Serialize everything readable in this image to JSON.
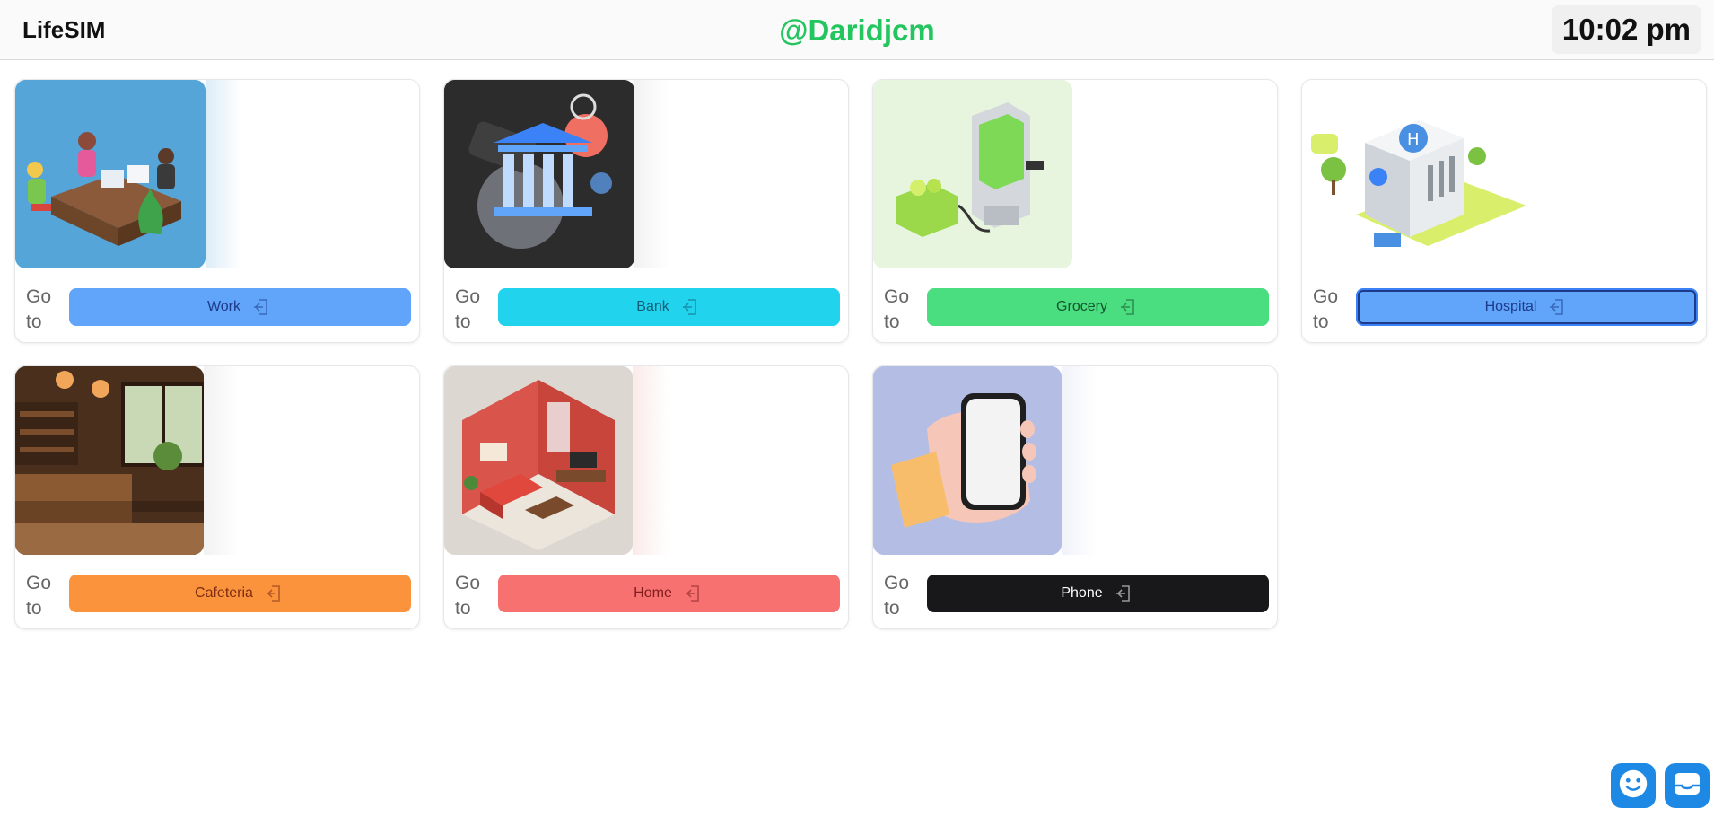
{
  "header": {
    "brand": "LifeSIM",
    "username": "@Daridjcm",
    "time": "10:02 pm"
  },
  "cards": [
    {
      "goto_text": "Go to",
      "label": "Work",
      "bg": "#60a5fa",
      "text_color": "#1e3a8a",
      "image": "office-workers-illustration"
    },
    {
      "goto_text": "Go to",
      "label": "Bank",
      "bg": "#22d3ee",
      "text_color": "#155e75",
      "image": "bank-building-illustration"
    },
    {
      "goto_text": "Go to",
      "label": "Grocery",
      "bg": "#4ade80",
      "text_color": "#14532d",
      "image": "grocery-kiosk-illustration"
    },
    {
      "goto_text": "Go to",
      "label": "Hospital",
      "bg": "#60a5fa",
      "text_color": "#1e3a8a",
      "image": "hospital-building-illustration"
    },
    {
      "goto_text": "Go to",
      "label": "Cafeteria",
      "bg": "#fb923c",
      "text_color": "#7c2d12",
      "image": "cafeteria-interior-illustration"
    },
    {
      "goto_text": "Go to",
      "label": "Home",
      "bg": "#f87171",
      "text_color": "#7f1d1d",
      "image": "living-room-illustration"
    },
    {
      "goto_text": "Go to",
      "label": "Phone",
      "bg": "#18181b",
      "text_color": "#ffffff",
      "image": "hand-holding-phone-illustration"
    }
  ],
  "floating": {
    "emoji_button_icon": "smiley-face-icon",
    "inbox_button_icon": "inbox-tray-icon"
  }
}
